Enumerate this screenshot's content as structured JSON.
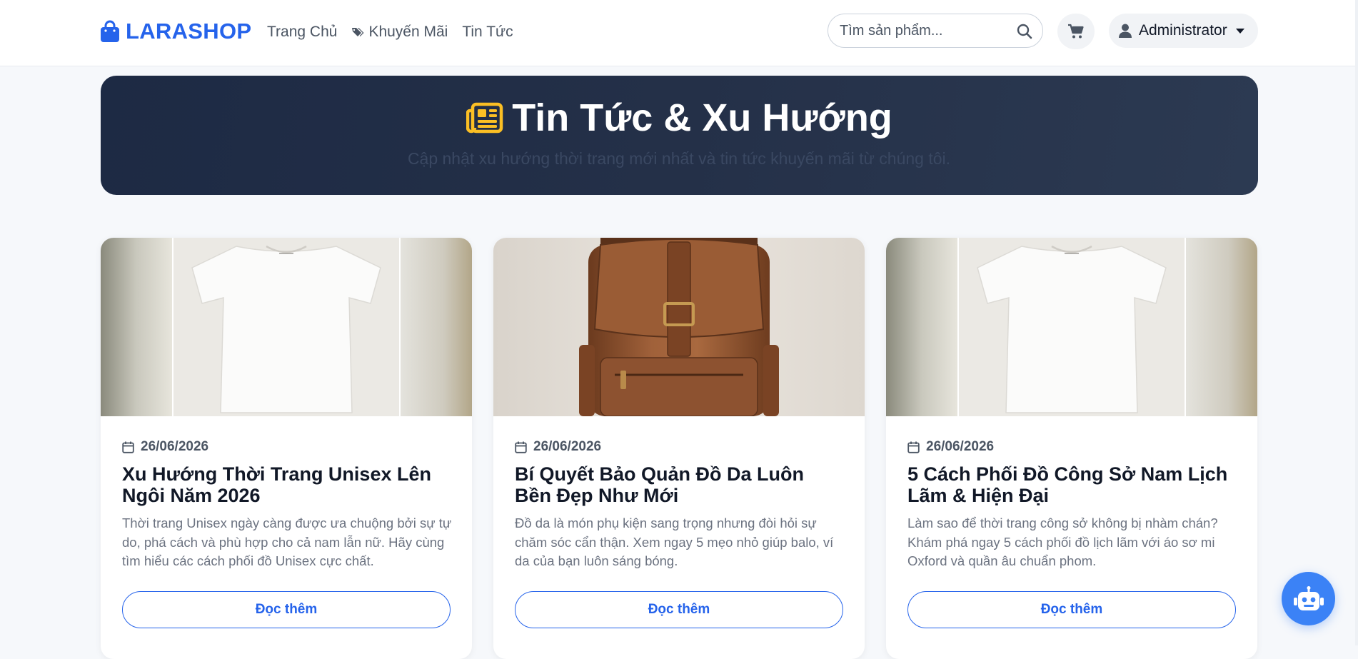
{
  "brand": {
    "name": "LARASHOP",
    "color": "#2563eb",
    "icon": "shopping-bag-icon"
  },
  "nav": [
    {
      "label": "Trang Chủ",
      "icon": ""
    },
    {
      "label": "Khuyến Mãi",
      "icon": "tags-icon"
    },
    {
      "label": "Tin Tức",
      "icon": ""
    }
  ],
  "search": {
    "placeholder": "Tìm sản phẩm...",
    "value": "",
    "icon": "search-icon"
  },
  "cart": {
    "icon": "cart-icon"
  },
  "user": {
    "name": "Administrator",
    "icon": "user-icon"
  },
  "hero": {
    "title": "Tin Tức & Xu Hướng",
    "icon": "newspaper-icon",
    "subtitle": "Cập nhật xu hướng thời trang mới nhất và tin tức khuyến mãi từ chúng tôi.",
    "icon_color": "#fbbf24"
  },
  "articles": [
    {
      "image": "white-tshirt",
      "date": "26/06/2026",
      "title": "Xu Hướng Thời Trang Unisex Lên Ngôi Năm 2026",
      "excerpt": "Thời trang Unisex ngày càng được ưa chuộng bởi sự tự do, phá cách và phù hợp cho cả nam lẫn nữ. Hãy cùng tìm hiểu các cách phối đồ Unisex cực chất.",
      "button": "Đọc thêm"
    },
    {
      "image": "leather-backpack",
      "date": "26/06/2026",
      "title": "Bí Quyết Bảo Quản Đồ Da Luôn Bền Đẹp Như Mới",
      "excerpt": "Đồ da là món phụ kiện sang trọng nhưng đòi hỏi sự chăm sóc cẩn thận. Xem ngay 5 mẹo nhỏ giúp balo, ví da của bạn luôn sáng bóng.",
      "button": "Đọc thêm"
    },
    {
      "image": "white-tshirt",
      "date": "26/06/2026",
      "title": "5 Cách Phối Đồ Công Sở Nam Lịch Lãm & Hiện Đại",
      "excerpt": "Làm sao để thời trang công sở không bị nhàm chán? Khám phá ngay 5 cách phối đồ lịch lãm với áo sơ mi Oxford và quần âu chuẩn phom.",
      "button": "Đọc thêm"
    }
  ],
  "chatbot": {
    "icon": "robot-icon"
  }
}
